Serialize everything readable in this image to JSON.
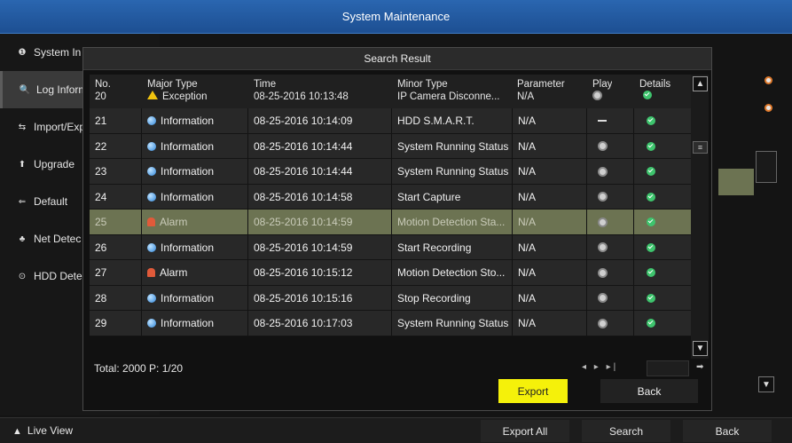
{
  "window": {
    "title": "System Maintenance"
  },
  "sidebar": {
    "items": [
      {
        "label": "System In",
        "icon": "info-icon",
        "glyph": "❶"
      },
      {
        "label": "Log Inform",
        "icon": "search-icon",
        "glyph": "🔍"
      },
      {
        "label": "Import/Exp",
        "icon": "import-export-icon",
        "glyph": "⇆"
      },
      {
        "label": "Upgrade",
        "icon": "upgrade-icon",
        "glyph": "⬆"
      },
      {
        "label": "Default",
        "icon": "default-icon",
        "glyph": "⇐"
      },
      {
        "label": "Net Detec",
        "icon": "network-icon",
        "glyph": "♣"
      },
      {
        "label": "HDD Dete",
        "icon": "hdd-icon",
        "glyph": "⊙"
      }
    ]
  },
  "modal": {
    "title": "Search Result",
    "columns": {
      "no": "No.",
      "major": "Major Type",
      "time": "Time",
      "minor": "Minor Type",
      "param": "Parameter",
      "play": "Play",
      "details": "Details"
    },
    "header_row": {
      "no": "20",
      "major": "Exception",
      "time": "08-25-2016 10:13:48",
      "minor": "IP Camera Disconne...",
      "param": "N/A"
    },
    "rows": [
      {
        "no": "21",
        "major": "Information",
        "time": "08-25-2016 10:14:09",
        "minor": "HDD S.M.A.R.T.",
        "param": "N/A",
        "play": "dash"
      },
      {
        "no": "22",
        "major": "Information",
        "time": "08-25-2016 10:14:44",
        "minor": "System Running Status",
        "param": "N/A",
        "play": "icon"
      },
      {
        "no": "23",
        "major": "Information",
        "time": "08-25-2016 10:14:44",
        "minor": "System Running Status",
        "param": "N/A",
        "play": "icon"
      },
      {
        "no": "24",
        "major": "Information",
        "time": "08-25-2016 10:14:58",
        "minor": "Start Capture",
        "param": "N/A",
        "play": "icon"
      },
      {
        "no": "25",
        "major": "Alarm",
        "time": "08-25-2016 10:14:59",
        "minor": "Motion Detection Sta...",
        "param": "N/A",
        "play": "icon"
      },
      {
        "no": "26",
        "major": "Information",
        "time": "08-25-2016 10:14:59",
        "minor": "Start Recording",
        "param": "N/A",
        "play": "icon"
      },
      {
        "no": "27",
        "major": "Alarm",
        "time": "08-25-2016 10:15:12",
        "minor": "Motion Detection Sto...",
        "param": "N/A",
        "play": "icon"
      },
      {
        "no": "28",
        "major": "Information",
        "time": "08-25-2016 10:15:16",
        "minor": "Stop Recording",
        "param": "N/A",
        "play": "icon"
      },
      {
        "no": "29",
        "major": "Information",
        "time": "08-25-2016 10:17:03",
        "minor": "System Running Status",
        "param": "N/A",
        "play": "icon"
      }
    ],
    "selected_row": "25",
    "total": "Total: 2000  P: 1/20",
    "export_label": "Export",
    "back_label": "Back"
  },
  "bottombar": {
    "live_view": "Live View",
    "export_all": "Export All",
    "search": "Search",
    "back": "Back"
  },
  "colors": {
    "title_bar": "#2a66b0",
    "selected_row": "#6c7352",
    "export_button": "#f5f10a",
    "details_ok": "#3ec46d",
    "info_icon": "#2d84d9",
    "alarm_icon": "#e05a3a",
    "warning_icon": "#f1c40f"
  }
}
